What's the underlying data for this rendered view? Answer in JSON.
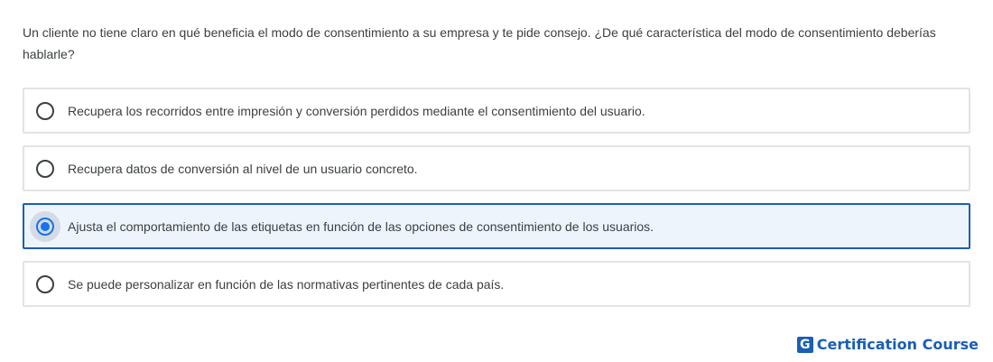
{
  "question": {
    "text": "Un cliente no tiene claro en qué beneficia el modo de consentimiento a su empresa y te pide consejo. ¿De qué característica del modo de consentimiento deberías hablarle?"
  },
  "options": [
    {
      "label": "Recupera los recorridos entre impresión y conversión perdidos mediante el consentimiento del usuario.",
      "selected": false
    },
    {
      "label": "Recupera datos de conversión al nivel de un usuario concreto.",
      "selected": false
    },
    {
      "label": "Ajusta el comportamiento de las etiquetas en función de las opciones de consentimiento de los usuarios.",
      "selected": true
    },
    {
      "label": "Se puede personalizar en función de las normativas pertinentes de cada país.",
      "selected": false
    }
  ],
  "brand": {
    "logo_letter": "G",
    "text": "Certification Course"
  },
  "colors": {
    "accent": "#1a73e8",
    "selected_border": "#1a5fb4",
    "selected_background": "#eef4fc",
    "brand": "#1a5fb4"
  }
}
